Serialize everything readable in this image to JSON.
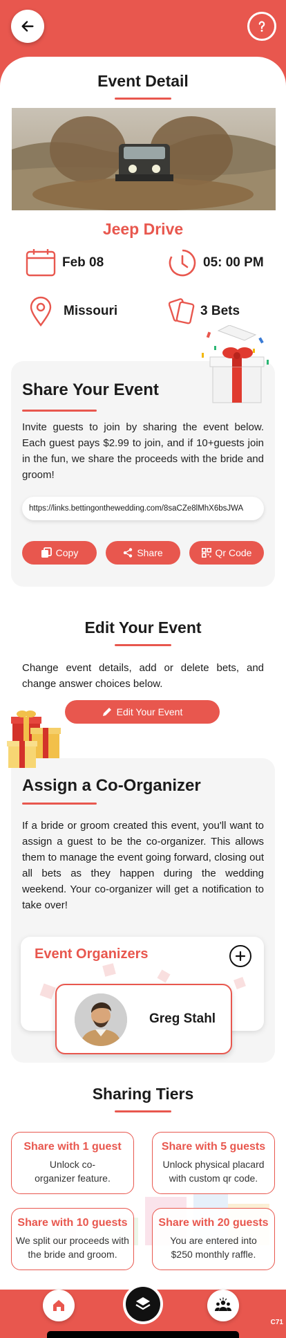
{
  "header": {
    "back_icon": "arrow-left-icon",
    "help_icon": "question-mark-icon"
  },
  "event": {
    "section_title": "Event Detail",
    "name": "Jeep Drive",
    "date": "Feb 08",
    "time": "05: 00 PM",
    "location": "Missouri",
    "bets": "3 Bets"
  },
  "share": {
    "title": "Share Your Event",
    "text": "Invite guests to join by sharing the event below. Each guest pays $2.99 to join, and if 10+guests join in the fun, we share the proceeds with the bride and groom!",
    "link": "https://links.bettingonthewedding.com/8saCZe8lMhX6bsJWA",
    "copy_label": "Copy",
    "share_label": "Share",
    "qr_label": "Qr Code"
  },
  "edit": {
    "title": "Edit Your Event",
    "text": "Change event details, add or delete bets, and change answer choices below.",
    "button_label": "Edit Your Event"
  },
  "co_organizer": {
    "title": "Assign a Co-Organizer",
    "text": "If a bride or groom created this event, you'll want to assign a guest to be the co-organizer. This allows them to manage the event going forward, closing out all bets as they happen during the wedding weekend. Your co-organizer will get a notification to take over!",
    "organizers_title": "Event Organizers",
    "organizer_name": "Greg Stahl"
  },
  "tiers": {
    "title": "Sharing Tiers",
    "items": [
      {
        "title": "Share with 1 guest",
        "desc": "Unlock co-organizer feature."
      },
      {
        "title": "Share with 5 guests",
        "desc": "Unlock physical placard with custom qr code."
      },
      {
        "title": "Share with 10 guests",
        "desc": "We split our proceeds with the bride and groom."
      },
      {
        "title": "Share with 20 guests",
        "desc": "You are entered into $250 monthly raffle."
      }
    ]
  },
  "nav": {
    "home_icon": "home-icon",
    "layers_icon": "layers-icon",
    "group_icon": "group-icon"
  },
  "corner_code": "C71",
  "colors": {
    "accent": "#e8574e",
    "card_bg": "#f5f5f5"
  }
}
